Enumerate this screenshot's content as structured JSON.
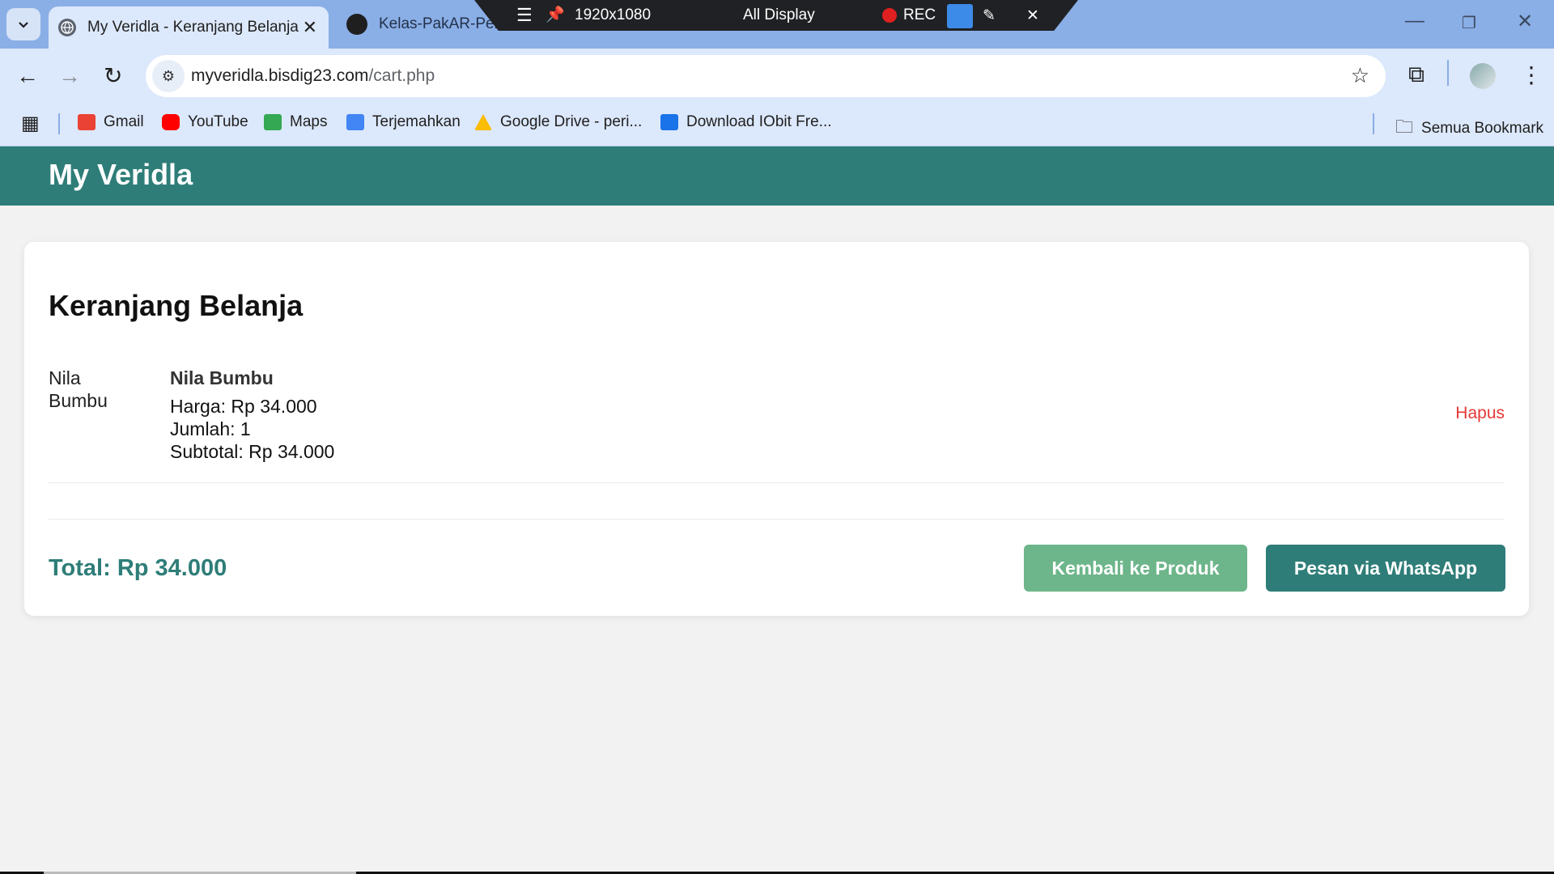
{
  "browser": {
    "tabs": [
      {
        "title": "My Veridla - Keranjang Belanja",
        "active": true
      },
      {
        "title": "Kelas-PakAR-Peran",
        "active": false
      }
    ],
    "recorder": {
      "resolution": "1920x1080",
      "mode": "All Display",
      "rec_label": "REC"
    },
    "url_host": "myveridla.bisdig23.com",
    "url_path": "/cart.php",
    "bookmarks": [
      {
        "label": "Gmail",
        "icon": "gmail-icon",
        "color": "#ea4335"
      },
      {
        "label": "YouTube",
        "icon": "youtube-icon",
        "color": "#ff0000"
      },
      {
        "label": "Maps",
        "icon": "maps-icon",
        "color": "#34a853"
      },
      {
        "label": "Terjemahkan",
        "icon": "translate-icon",
        "color": "#4285f4"
      },
      {
        "label": "Google Drive - peri...",
        "icon": "drive-icon",
        "color": "#fbbc04"
      },
      {
        "label": "Download IObit Fre...",
        "icon": "iobit-icon",
        "color": "#1a73e8"
      }
    ],
    "all_bookmarks": "Semua Bookmark"
  },
  "site": {
    "brand": "My Veridla",
    "accent": "#2e7d78"
  },
  "cart": {
    "title": "Keranjang Belanja",
    "items": [
      {
        "image_alt": "Nila Bumbu",
        "name": "Nila Bumbu",
        "price": "Harga: Rp 34.000",
        "quantity": "Jumlah: 1",
        "subtotal": "Subtotal: Rp 34.000",
        "remove_label": "Hapus"
      }
    ],
    "total": "Total: Rp 34.000",
    "back_label": "Kembali ke Produk",
    "whatsapp_label": "Pesan via WhatsApp"
  }
}
